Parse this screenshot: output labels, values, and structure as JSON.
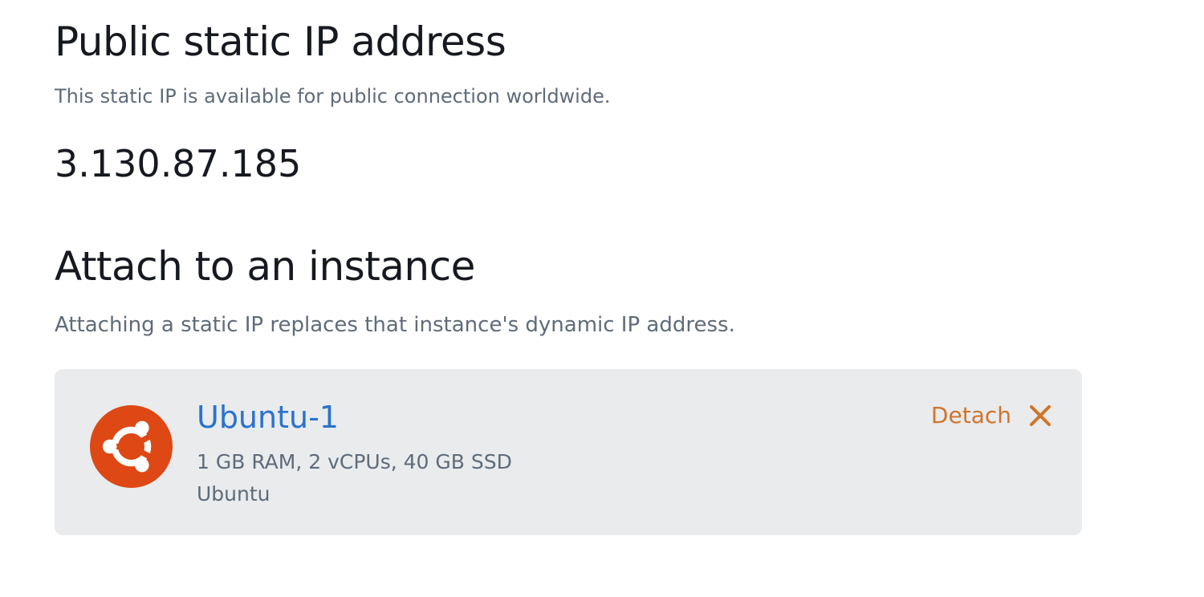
{
  "public_ip": {
    "title": "Public static IP address",
    "description": "This static IP is available for public connection worldwide.",
    "address": "3.130.87.185"
  },
  "attach": {
    "title": "Attach to an instance",
    "description": "Attaching a static IP replaces that instance's dynamic IP address.",
    "instance": {
      "name": "Ubuntu-1",
      "specs": "1 GB RAM, 2 vCPUs, 40 GB SSD",
      "os": "Ubuntu",
      "icon": "ubuntu-logo",
      "detach_label": "Detach",
      "detach_icon": "close-icon"
    }
  },
  "colors": {
    "link": "#2a73cc",
    "accent": "#d0742a",
    "ubuntu": "#dd4814",
    "card_bg": "#e9ebed",
    "muted_text": "#5f6b7a"
  }
}
